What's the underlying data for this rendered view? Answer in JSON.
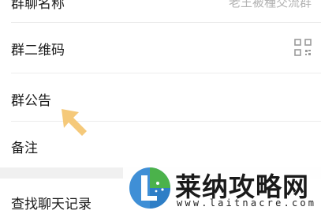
{
  "settings": {
    "group_name": {
      "label": "群聊名称",
      "value": "老王被種交流群"
    },
    "group_qr": {
      "label": "群二维码"
    },
    "group_notice": {
      "label": "群公告"
    },
    "remark": {
      "label": "备注"
    },
    "search_history": {
      "label": "查找聊天记录"
    }
  },
  "icons": {
    "qr": "qr-code-icon",
    "pointer": "arrow-pointer-icon"
  },
  "colors": {
    "arrow": "#f5c97a",
    "text": "#1a1a1a",
    "muted": "#b2b2b2",
    "section_gap": "#f0f0f0"
  },
  "watermark": {
    "name": "莱纳攻略网",
    "url": "www.laitnacre.com"
  }
}
